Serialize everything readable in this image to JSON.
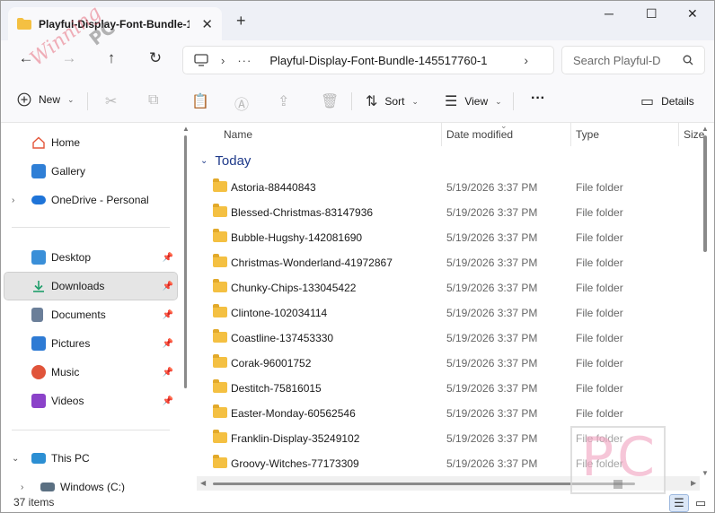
{
  "window": {
    "tab_title": "Playful-Display-Font-Bundle-1",
    "tab_close": "✕",
    "new_tab": "+",
    "minimize": "─",
    "maximize": "☐",
    "close": "✕"
  },
  "nav": {
    "back": "←",
    "forward": "→",
    "up": "↑",
    "refresh": "↻",
    "path_sep": "›",
    "path_ellipsis": "···",
    "path": "Playful-Display-Font-Bundle-145517760-1",
    "path_chevron": "›",
    "search_placeholder": "Search Playful-D"
  },
  "toolbar": {
    "new_label": "New",
    "sort_label": "Sort",
    "view_label": "View",
    "more_label": "···",
    "details_label": "Details"
  },
  "sidebar": {
    "items": [
      {
        "label": "Home",
        "icon": "home-icon",
        "color": "#e4553a"
      },
      {
        "label": "Gallery",
        "icon": "gallery-icon",
        "color": "#2f7fd6"
      },
      {
        "label": "OneDrive - Personal",
        "icon": "cloud-icon",
        "color": "#1e74d8"
      },
      {
        "label": "Desktop",
        "icon": "desktop-icon",
        "color": "#3a8fd8"
      },
      {
        "label": "Downloads",
        "icon": "download-icon",
        "color": "#1f9e6a"
      },
      {
        "label": "Documents",
        "icon": "document-icon",
        "color": "#6b7f99"
      },
      {
        "label": "Pictures",
        "icon": "pictures-icon",
        "color": "#2e7bd4"
      },
      {
        "label": "Music",
        "icon": "music-icon",
        "color": "#e0543a"
      },
      {
        "label": "Videos",
        "icon": "video-icon",
        "color": "#8b42c9"
      },
      {
        "label": "This PC",
        "icon": "computer-icon",
        "color": "#2c8fd3"
      },
      {
        "label": "Windows (C:)",
        "icon": "drive-icon",
        "color": "#5b7082"
      }
    ]
  },
  "columns": {
    "name": "Name",
    "date": "Date modified",
    "type": "Type",
    "size": "Size"
  },
  "group": {
    "label": "Today"
  },
  "files": [
    {
      "name": "Astoria-88440843",
      "date": "5/19/2026 3:37 PM",
      "type": "File folder"
    },
    {
      "name": "Blessed-Christmas-83147936",
      "date": "5/19/2026 3:37 PM",
      "type": "File folder"
    },
    {
      "name": "Bubble-Hugshy-142081690",
      "date": "5/19/2026 3:37 PM",
      "type": "File folder"
    },
    {
      "name": "Christmas-Wonderland-41972867",
      "date": "5/19/2026 3:37 PM",
      "type": "File folder"
    },
    {
      "name": "Chunky-Chips-133045422",
      "date": "5/19/2026 3:37 PM",
      "type": "File folder"
    },
    {
      "name": "Clintone-102034114",
      "date": "5/19/2026 3:37 PM",
      "type": "File folder"
    },
    {
      "name": "Coastline-137453330",
      "date": "5/19/2026 3:37 PM",
      "type": "File folder"
    },
    {
      "name": "Corak-96001752",
      "date": "5/19/2026 3:37 PM",
      "type": "File folder"
    },
    {
      "name": "Destitch-75816015",
      "date": "5/19/2026 3:37 PM",
      "type": "File folder"
    },
    {
      "name": "Easter-Monday-60562546",
      "date": "5/19/2026 3:37 PM",
      "type": "File folder"
    },
    {
      "name": "Franklin-Display-35249102",
      "date": "5/19/2026 3:37 PM",
      "type": "File folder"
    },
    {
      "name": "Groovy-Witches-77173309",
      "date": "5/19/2026 3:37 PM",
      "type": "File folder"
    }
  ],
  "status": {
    "item_count": "37 items"
  },
  "watermark": {
    "text": "Winning",
    "brand": "PC",
    "logo": "PC"
  }
}
